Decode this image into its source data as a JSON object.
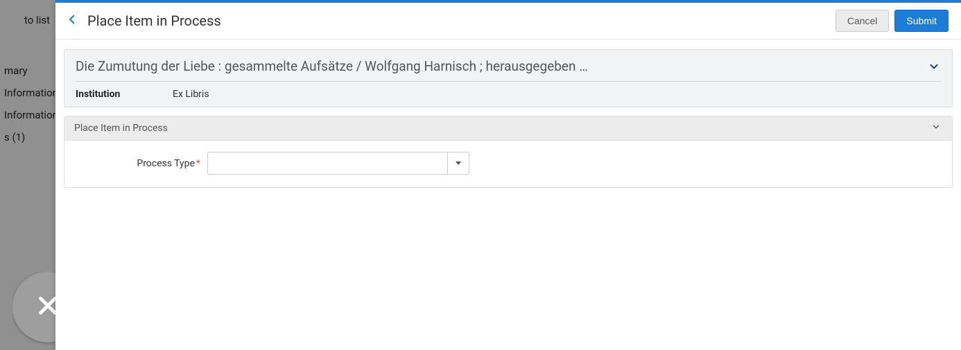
{
  "backdrop": {
    "top_link": "to list",
    "nav_items": [
      "mary",
      "Information",
      "Information",
      "s (1)"
    ]
  },
  "header": {
    "title": "Place Item in Process",
    "cancel_label": "Cancel",
    "submit_label": "Submit"
  },
  "summary": {
    "title": "Die Zumutung der Liebe : gesammelte Aufsätze / Wolfgang Harnisch ; herausgegeben …",
    "institution_label": "Institution",
    "institution_value": "Ex Libris"
  },
  "section": {
    "title": "Place Item in Process",
    "process_type_label": "Process Type",
    "process_type_value": ""
  }
}
